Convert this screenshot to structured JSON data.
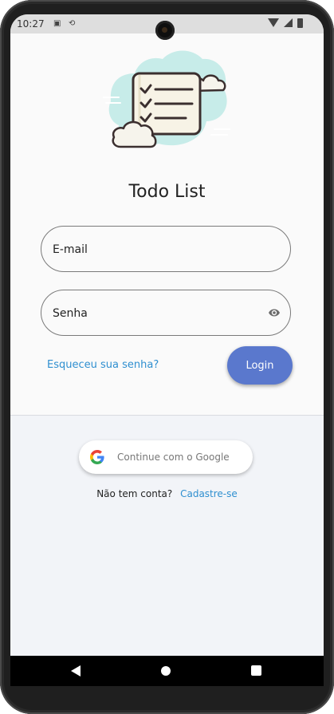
{
  "status_bar": {
    "time": "10:27",
    "icons": [
      "a-icon",
      "sync-icon",
      "wifi-icon",
      "signal-icon",
      "battery-icon"
    ]
  },
  "app": {
    "title": "Todo List"
  },
  "form": {
    "email_label": "E-mail",
    "password_label": "Senha",
    "forgot_password": "Esqueceu sua senha?",
    "login_button": "Login"
  },
  "social": {
    "google_button": "Continue com o Google"
  },
  "signup": {
    "prompt": "Não tem conta?",
    "link": "Cadastre-se"
  },
  "colors": {
    "primary": "#5a78cd",
    "link": "#2f8fd0",
    "cloud": "#c7ece9",
    "lower_bg": "#f2f4f8"
  }
}
